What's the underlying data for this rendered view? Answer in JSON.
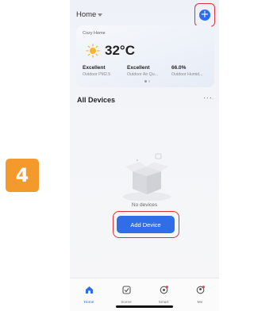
{
  "step": {
    "number": "4"
  },
  "header": {
    "home_label": "Home"
  },
  "weather": {
    "home_name": "Cozy Home",
    "temperature": "32°C",
    "stats": [
      {
        "value": "Excellent",
        "label": "Outdoor PM2.5"
      },
      {
        "value": "Excellent",
        "label": "Outdoor Air Qu..."
      },
      {
        "value": "66.0%",
        "label": "Outdoor Humid..."
      }
    ]
  },
  "devices": {
    "title": "All Devices",
    "more_icon": "more-icon",
    "empty_text": "No devices",
    "add_label": "Add Device"
  },
  "tabs": [
    {
      "label": "Home",
      "icon": "home-icon",
      "active": true
    },
    {
      "label": "Scene",
      "icon": "scene-icon",
      "active": false
    },
    {
      "label": "Smart",
      "icon": "smart-icon",
      "active": false
    },
    {
      "label": "Me",
      "icon": "me-icon",
      "active": false
    }
  ],
  "colors": {
    "accent": "#2d6cf0",
    "highlight": "#d9333f",
    "step_badge": "#f49a2c"
  }
}
